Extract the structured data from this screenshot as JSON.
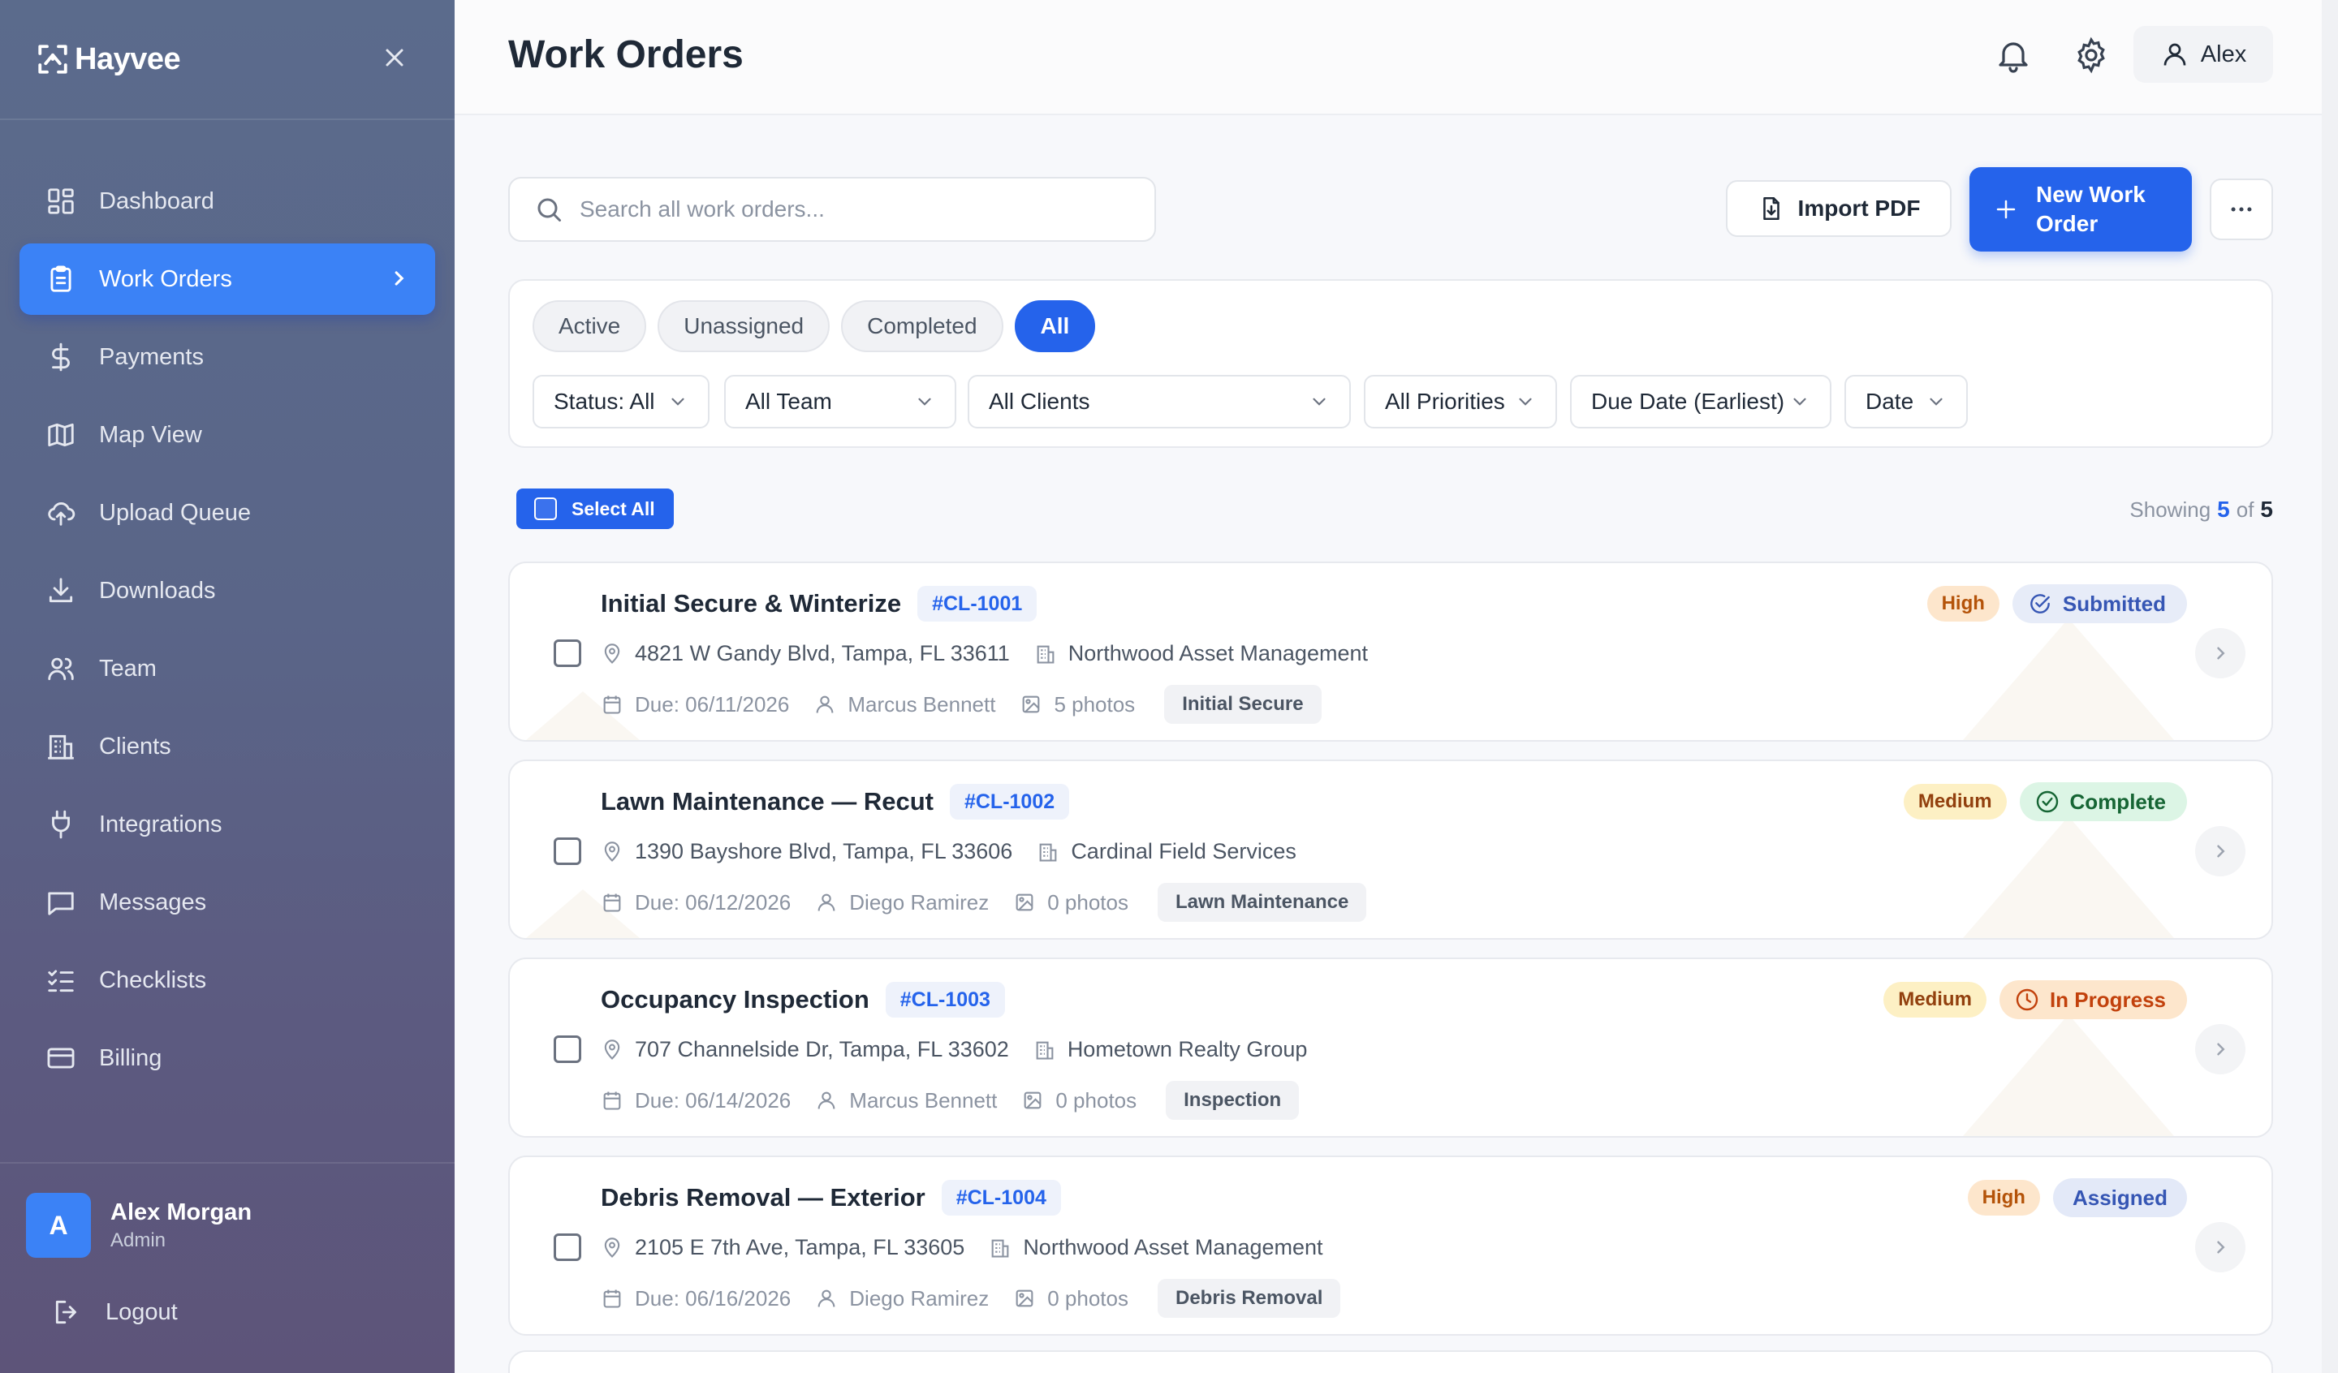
{
  "app": {
    "name": "Hayvee"
  },
  "sidebar": {
    "items": [
      {
        "label": "Dashboard",
        "icon": "dashboard-icon"
      },
      {
        "label": "Work Orders",
        "icon": "clipboard-icon",
        "active": true
      },
      {
        "label": "Payments",
        "icon": "dollar-icon"
      },
      {
        "label": "Map View",
        "icon": "map-icon"
      },
      {
        "label": "Upload Queue",
        "icon": "cloud-upload-icon"
      },
      {
        "label": "Downloads",
        "icon": "download-icon"
      },
      {
        "label": "Team",
        "icon": "users-icon"
      },
      {
        "label": "Clients",
        "icon": "building-icon"
      },
      {
        "label": "Integrations",
        "icon": "plug-icon"
      },
      {
        "label": "Messages",
        "icon": "message-icon"
      },
      {
        "label": "Checklists",
        "icon": "checklist-icon"
      },
      {
        "label": "Billing",
        "icon": "credit-card-icon"
      }
    ],
    "user": {
      "initial": "A",
      "name": "Alex Morgan",
      "role": "Admin"
    },
    "logout_label": "Logout"
  },
  "header": {
    "title": "Work Orders",
    "user_label": "Alex"
  },
  "toolbar": {
    "search_placeholder": "Search all work orders...",
    "import_label": "Import PDF",
    "new_label": "New Work Order"
  },
  "filters": {
    "tabs": [
      {
        "label": "Active"
      },
      {
        "label": "Unassigned"
      },
      {
        "label": "Completed"
      },
      {
        "label": "All",
        "active": true
      }
    ],
    "selects": [
      {
        "value": "Status: All"
      },
      {
        "value": "All Team"
      },
      {
        "value": "All Clients"
      },
      {
        "value": "All Priorities"
      },
      {
        "value": "Due Date (Earliest)"
      },
      {
        "value": "Date"
      }
    ]
  },
  "list": {
    "select_all_label": "Select All",
    "showing_label": "Showing",
    "showing_count": "5",
    "of_label": "of",
    "total_count": "5"
  },
  "work_orders": [
    {
      "title": "Initial Secure & Winterize",
      "code": "#CL-1001",
      "address": "4821 W Gandy Blvd, Tampa, FL 33611",
      "client": "Northwood Asset Management",
      "due": "Due: 06/11/2026",
      "assignee": "Marcus Bennett",
      "photos": "5 photos",
      "type": "Initial Secure",
      "priority": "High",
      "status": "Submitted"
    },
    {
      "title": "Lawn Maintenance — Recut",
      "code": "#CL-1002",
      "address": "1390 Bayshore Blvd, Tampa, FL 33606",
      "client": "Cardinal Field Services",
      "due": "Due: 06/12/2026",
      "assignee": "Diego Ramirez",
      "photos": "0 photos",
      "type": "Lawn Maintenance",
      "priority": "Medium",
      "status": "Complete"
    },
    {
      "title": "Occupancy Inspection",
      "code": "#CL-1003",
      "address": "707 Channelside Dr, Tampa, FL 33602",
      "client": "Hometown Realty Group",
      "due": "Due: 06/14/2026",
      "assignee": "Marcus Bennett",
      "photos": "0 photos",
      "type": "Inspection",
      "priority": "Medium",
      "status": "In Progress"
    },
    {
      "title": "Debris Removal — Exterior",
      "code": "#CL-1004",
      "address": "2105 E 7th Ave, Tampa, FL 33605",
      "client": "Northwood Asset Management",
      "due": "Due: 06/16/2026",
      "assignee": "Diego Ramirez",
      "photos": "0 photos",
      "type": "Debris Removal",
      "priority": "High",
      "status": "Assigned"
    }
  ]
}
